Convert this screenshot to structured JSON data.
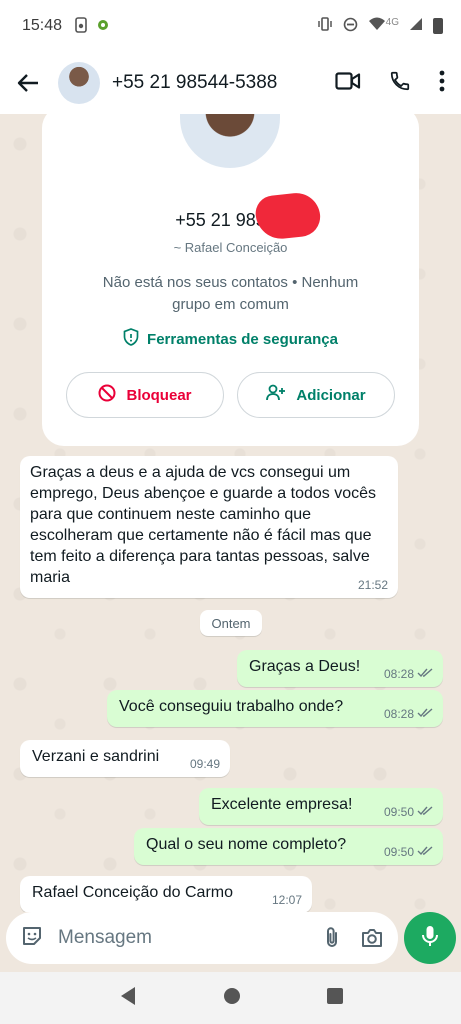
{
  "status_bar": {
    "time": "15:48",
    "network": "4G"
  },
  "header": {
    "title": "+55 21 98544-5388",
    "icons": [
      "back-arrow-icon",
      "video-call-icon",
      "voice-call-icon",
      "more-options-icon"
    ]
  },
  "contact_card": {
    "phone": "+55 21 98544",
    "alias": "~ Rafael Conceição",
    "info": "Não está nos seus contatos • Nenhum grupo em comum",
    "safety_tools": "Ferramentas de segurança",
    "block_label": "Bloquear",
    "add_label": "Adicionar"
  },
  "messages": [
    {
      "direction": "in",
      "text": "Graças a deus e a ajuda de vcs consegui um emprego, Deus abençoe e guarde a todos vocês para que continuem neste caminho que escolheram que certamente não é fácil mas que tem feito a diferença para tantas pessoas, salve maria",
      "time": "21:52"
    },
    {
      "direction": "out",
      "text": "Graças a Deus!",
      "time": "08:28"
    },
    {
      "direction": "out",
      "text": "Você conseguiu trabalho onde?",
      "time": "08:28"
    },
    {
      "direction": "in",
      "text": "Verzani e sandrini",
      "time": "09:49"
    },
    {
      "direction": "out",
      "text": "Excelente empresa!",
      "time": "09:50"
    },
    {
      "direction": "out",
      "text": "Qual o seu nome completo?",
      "time": "09:50"
    },
    {
      "direction": "in",
      "text": "Rafael Conceição do Carmo",
      "time": "12:07"
    }
  ],
  "date_separator": "Ontem",
  "composer": {
    "placeholder": "Mensagem"
  },
  "colors": {
    "accent": "#008069",
    "outgoing_bubble": "#d9fdd3",
    "incoming_bubble": "#ffffff",
    "chat_background": "#efe7de",
    "block_red": "#ea0038",
    "mic_green": "#1daa61"
  }
}
